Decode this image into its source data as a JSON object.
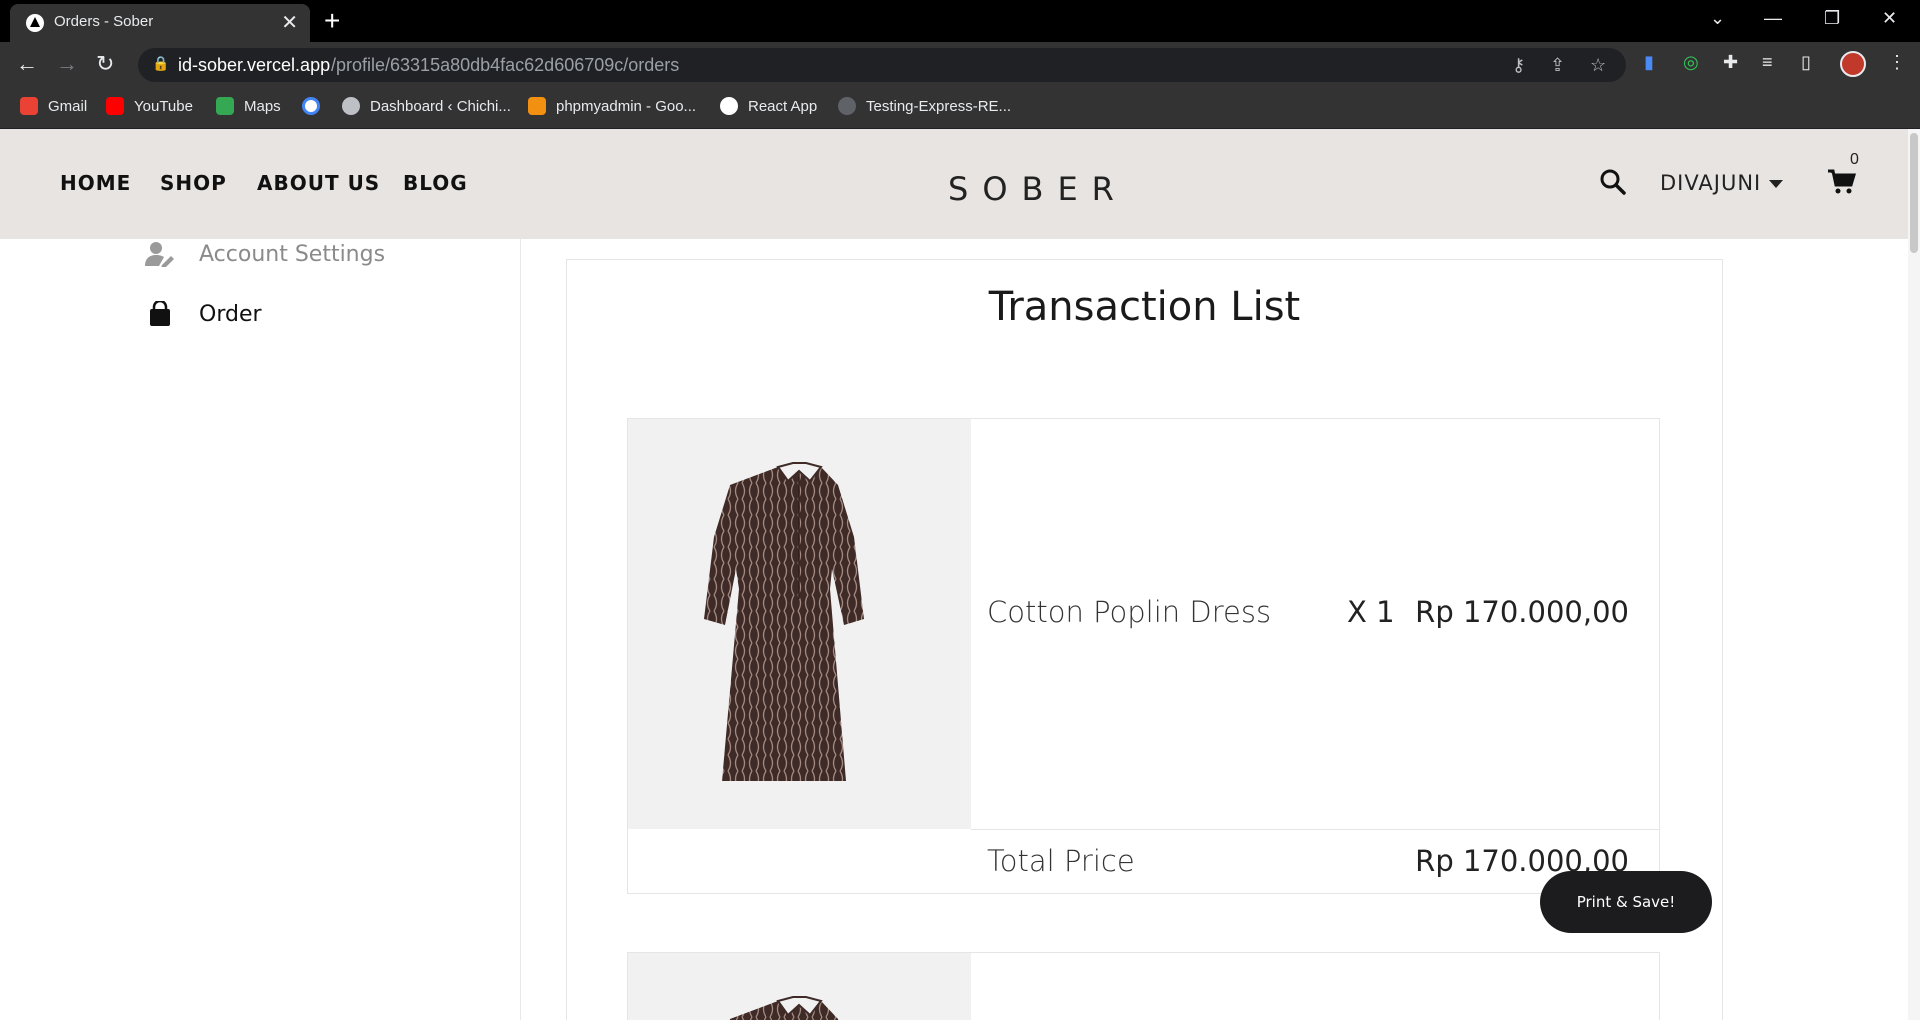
{
  "browser": {
    "tab_title": "Orders - Sober",
    "tab_close": "✕",
    "new_tab": "+",
    "url_host": "id-sober.vercel.app",
    "url_path": "/profile/63315a80db4fac62d606709c/orders",
    "window_controls": [
      "⌄",
      "—",
      "❐",
      "✕"
    ],
    "bookmarks": [
      {
        "label": "Gmail",
        "icon": "gmail-icon",
        "color": "#ea4335"
      },
      {
        "label": "YouTube",
        "icon": "youtube-icon",
        "color": "#ff0000"
      },
      {
        "label": "Maps",
        "icon": "maps-icon",
        "color": "#34a853"
      },
      {
        "label": "",
        "icon": "google-icon",
        "color": "#4285f4"
      },
      {
        "label": "Dashboard ‹ Chichi...",
        "icon": "wordpress-icon",
        "color": "#bdc1c6"
      },
      {
        "label": "phpmyadmin - Goo...",
        "icon": "phpmyadmin-icon",
        "color": "#f29111"
      },
      {
        "label": "React App",
        "icon": "react-app-icon",
        "color": "#ffffff"
      },
      {
        "label": "Testing-Express-RE...",
        "icon": "github-icon",
        "color": "#5f6368"
      }
    ]
  },
  "header": {
    "nav": [
      "HOME",
      "SHOP",
      "ABOUT US",
      "BLOG"
    ],
    "logo": "SOBER",
    "user": "DIVAJUNI",
    "cart_count": "0"
  },
  "sidebar": {
    "items": [
      {
        "label": "Account Settings",
        "icon": "user-edit-icon",
        "active": false
      },
      {
        "label": "Order",
        "icon": "shopping-bag-icon",
        "active": true
      }
    ]
  },
  "main": {
    "title": "Transaction List",
    "orders": [
      {
        "product": "Cotton Poplin Dress",
        "qty": "X 1",
        "price": "Rp 170.000,00",
        "total_label": "Total Price",
        "total": "Rp 170.000,00"
      }
    ],
    "print_button": "Print & Save!"
  },
  "colors": {
    "header_bg": "#e8e4e2",
    "button_dark": "#1c1c1e",
    "product_bg": "#f1f1f2",
    "dress": "#3e2a27"
  }
}
